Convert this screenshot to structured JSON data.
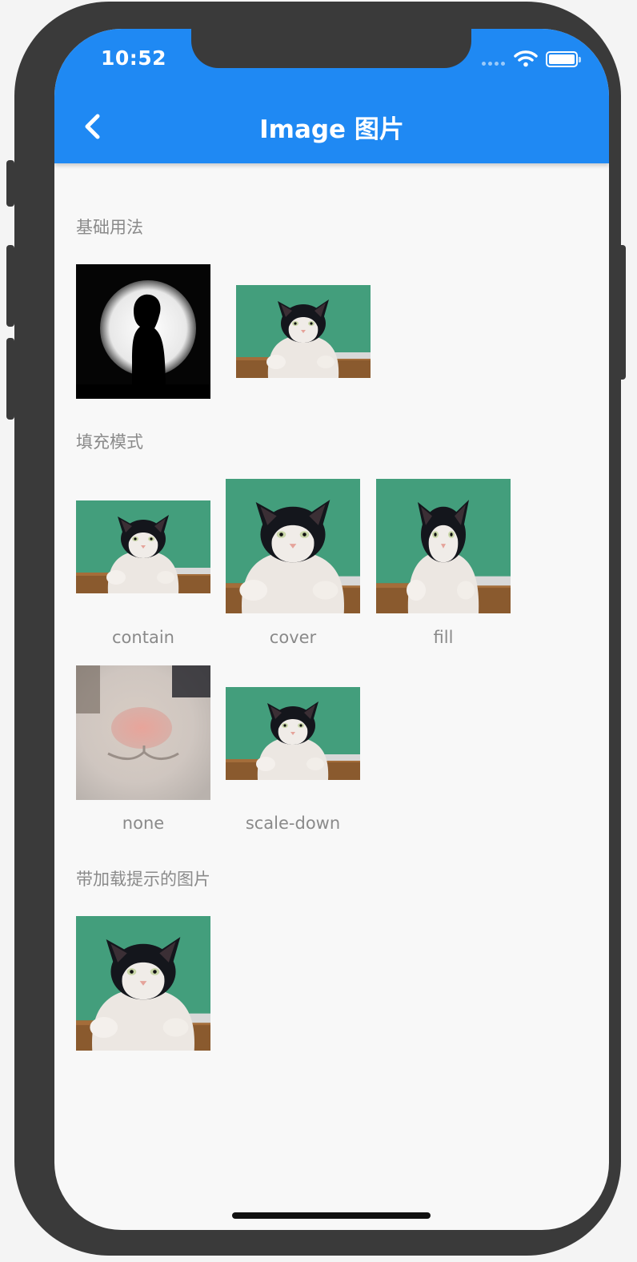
{
  "status_bar": {
    "time": "10:52",
    "wifi_icon": "wifi-icon",
    "battery_icon": "battery-icon"
  },
  "app_bar": {
    "title": "Image 图片",
    "back_icon": "chevron-left-icon",
    "color": "#1f89f3"
  },
  "sections": {
    "basic": {
      "title": "基础用法"
    },
    "fit": {
      "title": "填充模式",
      "captions": [
        "contain",
        "cover",
        "fill",
        "none",
        "scale-down"
      ]
    },
    "placeholder": {
      "title": "带加载提示的图片"
    }
  }
}
